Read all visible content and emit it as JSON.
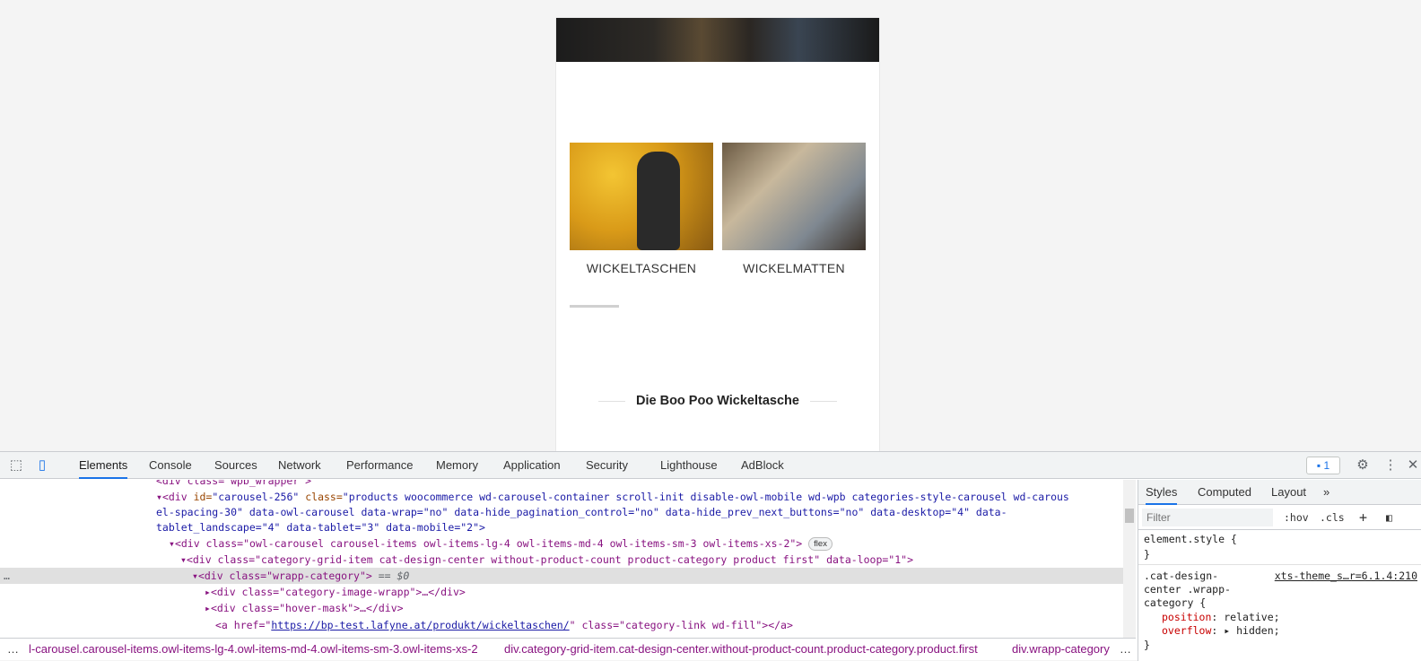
{
  "page": {
    "categories": [
      {
        "label": "WICKELTASCHEN"
      },
      {
        "label": "WICKELMATTEN"
      }
    ],
    "headline": "Die Boo Poo Wickeltasche"
  },
  "devtools": {
    "tabs": [
      "Elements",
      "Console",
      "Sources",
      "Network",
      "Performance",
      "Memory",
      "Application",
      "Security",
      "Lighthouse",
      "AdBlock"
    ],
    "active_tab": "Elements",
    "issues_count": "1",
    "dom": {
      "l0": "<div class=\"wpb_wrapper\">",
      "l1_tag": "<div",
      "l1_id": "id=",
      "l1_idval": "\"carousel-256\"",
      "l1_class": "class=",
      "l1_classval": "\"products woocommerce wd-carousel-container  scroll-init disable-owl-mobile wd-wpb categories-style-carousel  wd-carous",
      "l2": "el-spacing-30\" data-owl-carousel data-wrap=\"no\" data-hide_pagination_control=\"no\" data-hide_prev_next_buttons=\"no\" data-desktop=\"4\" data-",
      "l3": "tablet_landscape=\"4\" data-tablet=\"3\" data-mobile=\"2\">",
      "l4": "<div class=\"owl-carousel carousel-items owl-items-lg-4 owl-items-md-4 owl-items-sm-3 owl-items-xs-2\">",
      "l4_pill": "flex",
      "l5": "<div class=\"category-grid-item cat-design-center without-product-count product-category product first\" data-loop=\"1\">",
      "l6": "<div class=\"wrapp-category\">",
      "l6_eq": " == $0",
      "l7": "<div class=\"category-image-wrapp\">…</div>",
      "l8": "<div class=\"hover-mask\">…</div>",
      "l9_pre": "<a href=\"",
      "l9_link": "https://bp-test.lafyne.at/produkt/wickeltaschen/",
      "l9_post": "\" class=\"category-link wd-fill\"></a>"
    },
    "breadcrumbs": [
      "…",
      "l-carousel.carousel-items.owl-items-lg-4.owl-items-md-4.owl-items-sm-3.owl-items-xs-2",
      "div.category-grid-item.cat-design-center.without-product-count.product-category.product.first",
      "div.wrapp-category",
      "…"
    ],
    "styles": {
      "tabs": [
        "Styles",
        "Computed",
        "Layout"
      ],
      "filter_placeholder": "Filter",
      "hov": ":hov",
      "cls": ".cls",
      "element_style_open": "element.style {",
      "element_style_close": "}",
      "rule_selector_1": ".cat-design-",
      "rule_selector_2": "center .wrapp-",
      "rule_selector_3": "category {",
      "rule_source": "xts-theme_s…r=6.1.4:210",
      "prop1_name": "position",
      "prop1_value": " relative;",
      "prop2_name": "overflow",
      "prop2_value": " hidden;",
      "rule_close": "}"
    }
  }
}
